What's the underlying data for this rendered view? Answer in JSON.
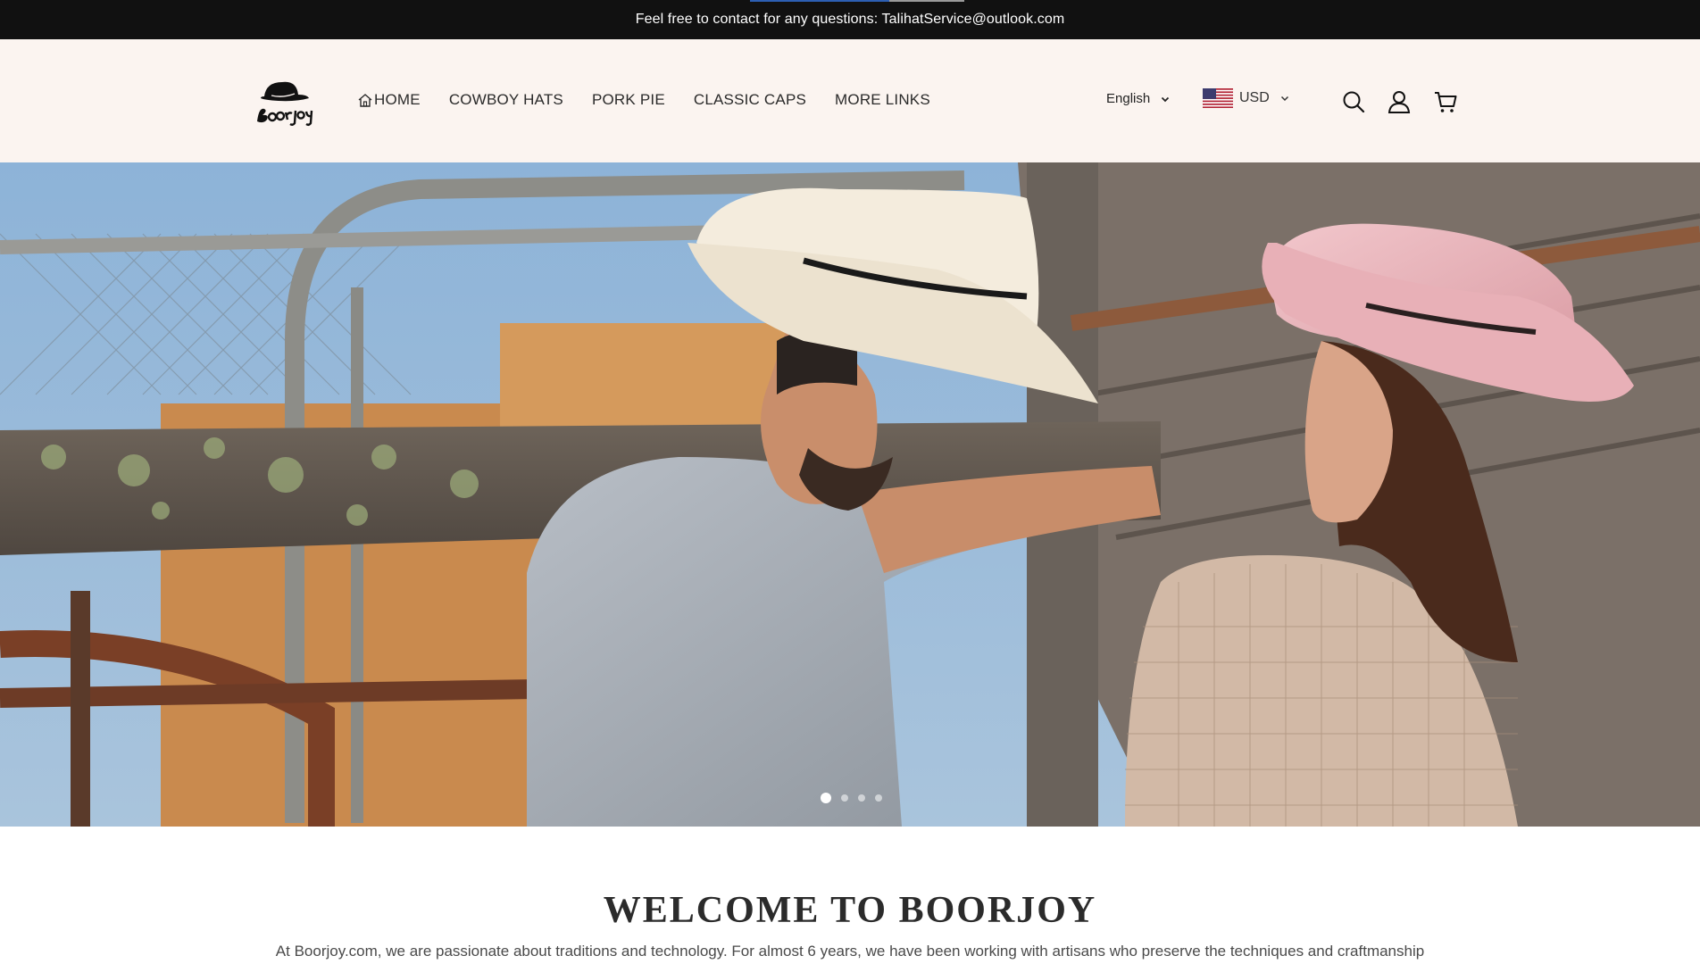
{
  "announcement": {
    "text": "Feel free to contact for any questions: TalihatService@outlook.com",
    "progress": 0.65
  },
  "header": {
    "logo_text": "Boorjoy",
    "nav": [
      {
        "label": "HOME",
        "icon": "home-icon"
      },
      {
        "label": "COWBOY HATS"
      },
      {
        "label": "PORK PIE"
      },
      {
        "label": "CLASSIC CAPS"
      },
      {
        "label": "MORE LINKS"
      }
    ],
    "language": "English",
    "currency": "USD",
    "icons": [
      "search-icon",
      "account-icon",
      "cart-icon"
    ]
  },
  "hero": {
    "slide_count": 4,
    "active_slide": 1
  },
  "welcome": {
    "title": "WELCOME TO BOORJOY",
    "text": "At Boorjoy.com, we are passionate about traditions and technology. For almost 6 years, we have been working with artisans who preserve the techniques and craftmanship"
  },
  "colors": {
    "announce_bg": "#111111",
    "header_bg": "#fbf4f0",
    "text": "#2a2a2a"
  }
}
